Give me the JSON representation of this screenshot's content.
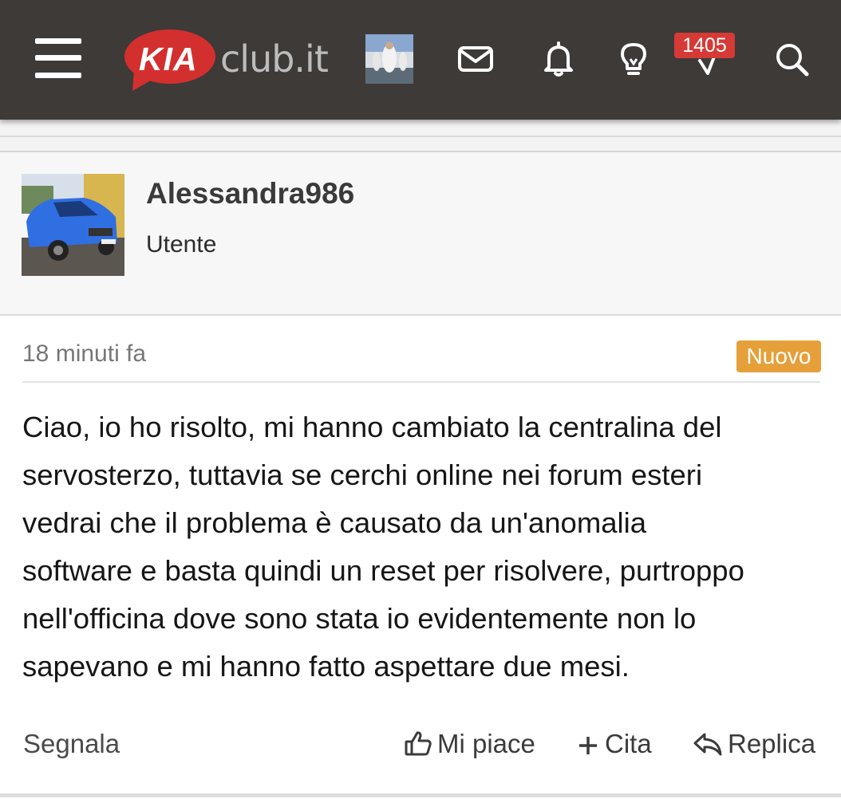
{
  "header": {
    "menu_icon": "hamburger-menu-icon",
    "logo": {
      "brand": "KIA",
      "suffix": "club.it",
      "brand_color": "#d32f2f"
    },
    "icons": [
      "mail-icon",
      "bell-icon",
      "lightbulb-icon",
      "activity-icon",
      "search-icon"
    ],
    "activity_count": "1405",
    "bg_color": "#3d3a38"
  },
  "post": {
    "author": {
      "name": "Alessandra986",
      "role": "Utente"
    },
    "time": "18 minuti fa",
    "new_badge": "Nuovo",
    "message": "Ciao, io ho risolto, mi hanno cambiato la centralina del\nservosterzo, tuttavia se cerchi online nei forum esteri\nvedrai che il problema è causato da un'anomalia\nsoftware e basta quindi un reset per risolvere, purtroppo\nnell'officina dove sono stata io evidentemente non lo\nsapevano e mi hanno fatto aspettare due mesi.",
    "actions": {
      "report": "Segnala",
      "like": "Mi piace",
      "quote": "Cita",
      "reply": "Replica"
    },
    "accent_new": "#e5a03a"
  }
}
